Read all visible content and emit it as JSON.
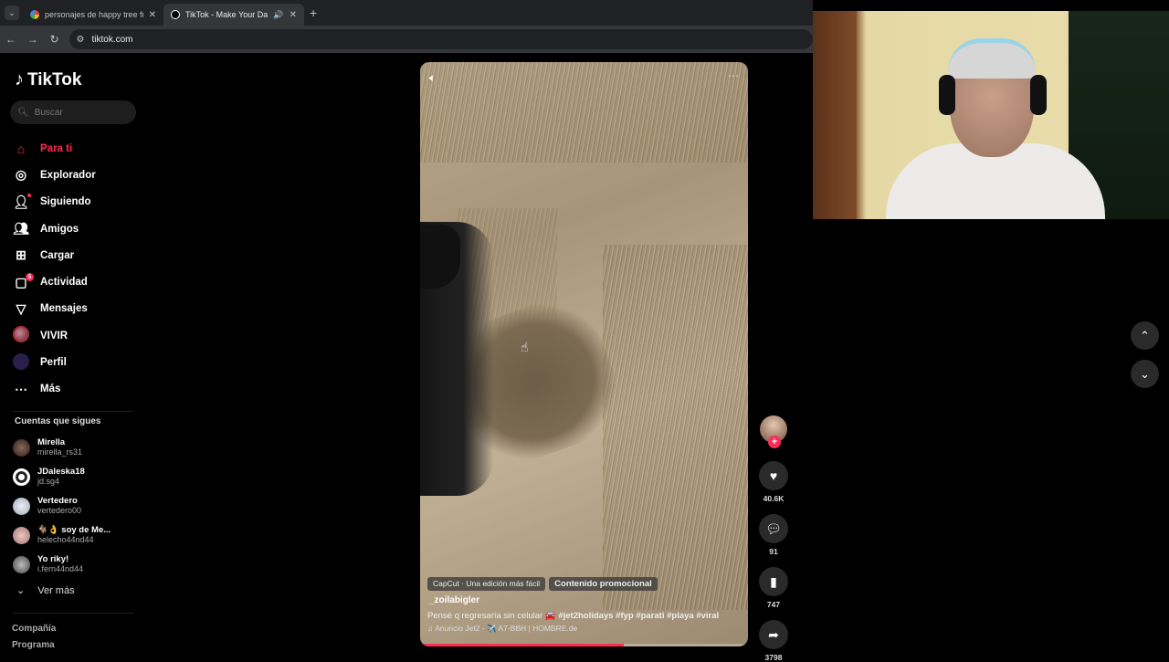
{
  "browser": {
    "tabs": [
      {
        "title": "personajes de happy tree friends",
        "active": false,
        "favicon": "google-icon"
      },
      {
        "title": "TikTok - Make Your Day",
        "active": true,
        "favicon": "tiktok-icon"
      }
    ],
    "url": "tiktok.com"
  },
  "app": {
    "name": "TikTok",
    "search_placeholder": "Buscar",
    "accent": "#fe2c55"
  },
  "nav": [
    {
      "label": "Para ti",
      "icon": "home-icon"
    },
    {
      "label": "Explorador",
      "icon": "compass-icon"
    },
    {
      "label": "Siguiendo",
      "icon": "following-icon"
    },
    {
      "label": "Amigos",
      "icon": "friends-icon"
    },
    {
      "label": "Cargar",
      "icon": "upload-icon"
    },
    {
      "label": "Actividad",
      "icon": "activity-icon",
      "badge": "5"
    },
    {
      "label": "Mensajes",
      "icon": "messages-icon"
    },
    {
      "label": "VIVIR",
      "icon": "live-avatar"
    },
    {
      "label": "Perfil",
      "icon": "profile-avatar"
    },
    {
      "label": "Más",
      "icon": "more-icon"
    }
  ],
  "following": {
    "title": "Cuentas que sigues",
    "accounts": [
      {
        "name": "Mirella",
        "handle": "mirella_rs31"
      },
      {
        "name": "JDaleska18",
        "handle": "jd.sg4"
      },
      {
        "name": "Vertedero",
        "handle": "vertedero00"
      },
      {
        "name": "🐐👌 soy de Me...",
        "handle": "helecho44nd44"
      },
      {
        "name": "Yo riky!",
        "handle": "i.fern44nd44"
      }
    ],
    "more_label": "Ver más"
  },
  "footer": {
    "line1": "Compañía",
    "line2": "Programa"
  },
  "video": {
    "capcut_chip": "CapCut · Una edición más fácil",
    "promo_chip": "Contenido promocional",
    "author": "_zoilabigler",
    "description": "Pensé q regresaría sin celular 🚘",
    "hashtags": "#jet2holidays #fyp #parati #playa #viral",
    "music": "♫ Anuncio Jet2 - ✈️ A7-BBH | HOMBRE.de",
    "progress": 0.62
  },
  "actions": {
    "likes": "40.6K",
    "comments": "91",
    "saves": "747",
    "shares": "3798"
  }
}
